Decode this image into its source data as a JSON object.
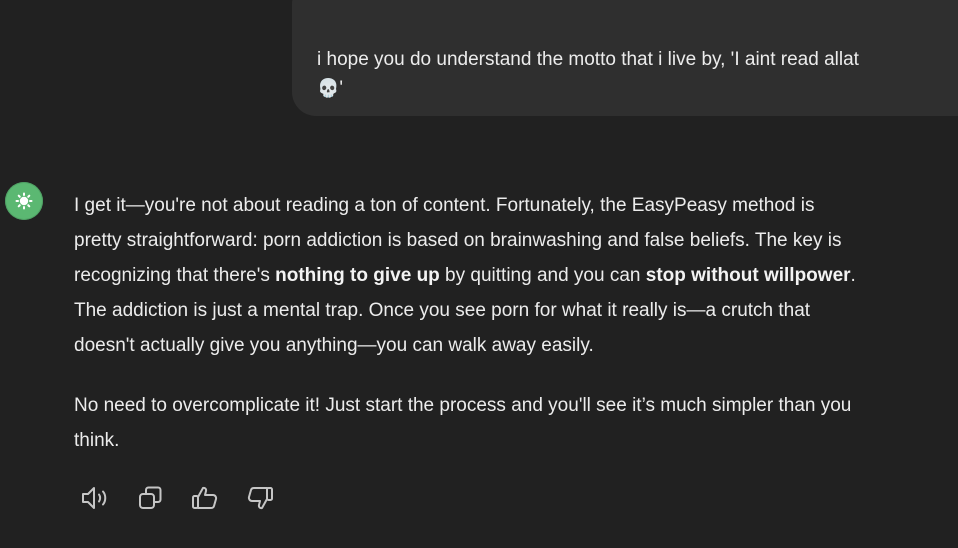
{
  "user_message": {
    "line1": "i hope you do understand the motto that i live by, 'I aint read allat",
    "emoji": "💀",
    "line2_suffix": "'"
  },
  "assistant": {
    "avatar_icon": "openai-logo-icon",
    "avatar_color": "#5bb872",
    "paragraph1": {
      "line1": "I get it—you're not about reading a ton of content. Fortunately, the EasyPeasy method is",
      "line2": "pretty straightforward: porn addiction is based on brainwashing and false beliefs. The key is",
      "line3_a": "recognizing that there's ",
      "line3_bold1": "nothing to give up",
      "line3_b": " by quitting and you can ",
      "line3_bold2": "stop without willpower",
      "line3_c": ".",
      "line4": "The addiction is just a mental trap. Once you see porn for what it really is—a crutch that",
      "line5": "doesn't actually give you anything—you can walk away easily."
    },
    "paragraph2": {
      "line1": "No need to overcomplicate it! Just start the process and you'll see it’s much simpler than you",
      "line2": "think."
    }
  },
  "actions": [
    {
      "icon": "speaker-icon"
    },
    {
      "icon": "copy-icon"
    },
    {
      "icon": "thumbs-up-icon"
    },
    {
      "icon": "thumbs-down-icon"
    }
  ]
}
